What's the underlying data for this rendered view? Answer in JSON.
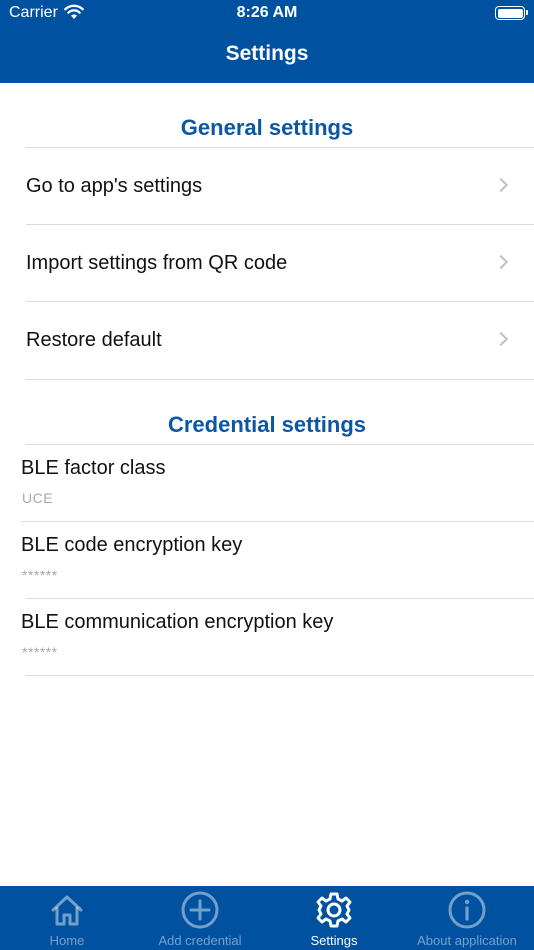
{
  "status_bar": {
    "carrier": "Carrier",
    "time": "8:26 AM"
  },
  "nav": {
    "title": "Settings"
  },
  "general": {
    "title": "General settings",
    "items": [
      {
        "label": "Go to app's settings"
      },
      {
        "label": "Import settings from QR code"
      },
      {
        "label": "Restore default"
      }
    ]
  },
  "credential": {
    "title": "Credential settings",
    "items": [
      {
        "label": "BLE factor class",
        "value": "UCE"
      },
      {
        "label": "BLE code encryption key",
        "value": "******"
      },
      {
        "label": "BLE communication encryption key",
        "value": "******"
      }
    ]
  },
  "tabs": [
    {
      "label": "Home",
      "icon": "home-icon",
      "active": false
    },
    {
      "label": "Add credential",
      "icon": "plus-circle-icon",
      "active": false
    },
    {
      "label": "Settings",
      "icon": "gear-icon",
      "active": true
    },
    {
      "label": "About application",
      "icon": "info-icon",
      "active": false
    }
  ],
  "colors": {
    "brand": "#0052a0",
    "section_title": "#0b57a3",
    "divider": "#dcdcdc",
    "muted": "#a8a8a8"
  }
}
